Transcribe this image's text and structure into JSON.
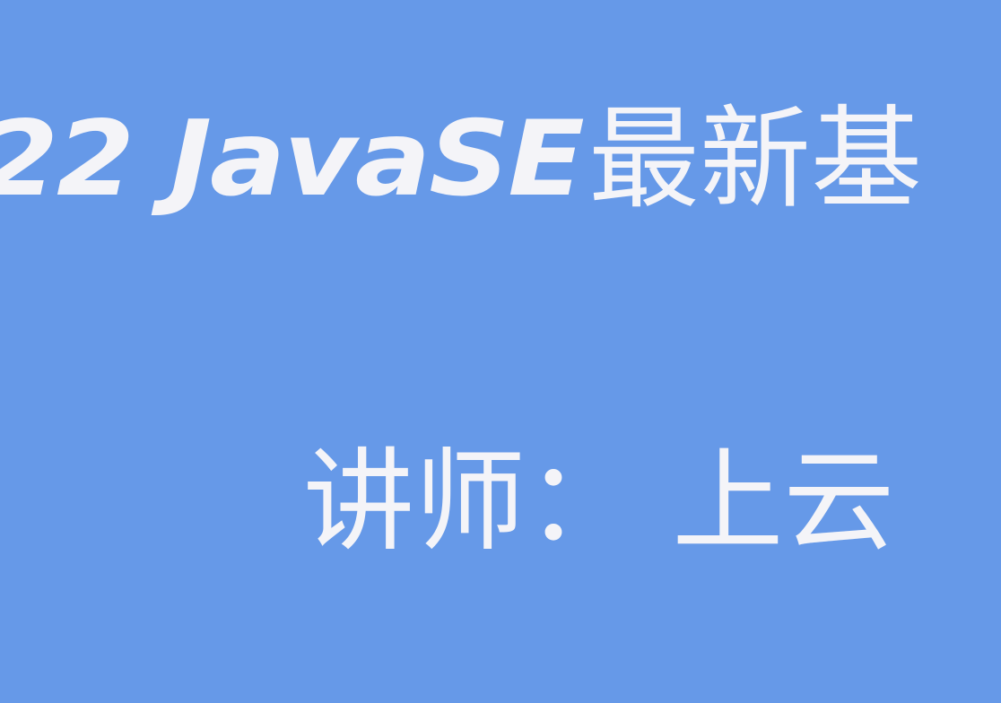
{
  "slide": {
    "background_color": "#6699E8",
    "text_color": "#F4F4F8",
    "title": {
      "latin": "22 JavaSE",
      "cjk": "最新基"
    },
    "lecturer": "讲师： 上云"
  }
}
